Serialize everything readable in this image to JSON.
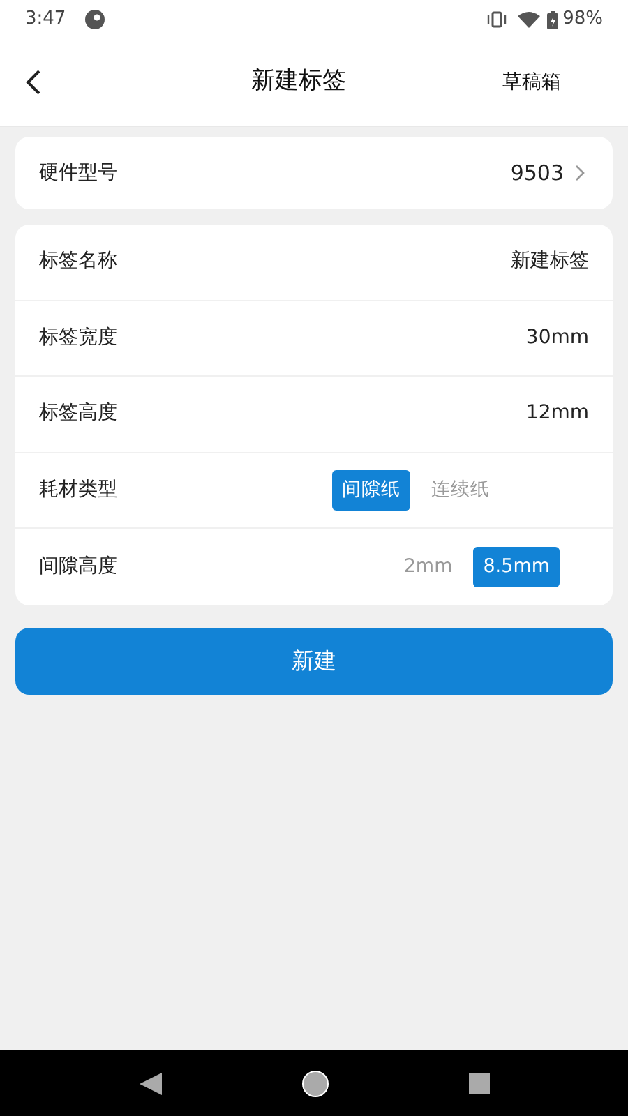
{
  "status_bar": {
    "time": "3:47",
    "battery": "98%"
  },
  "header": {
    "title": "新建标签",
    "action": "草稿箱"
  },
  "hardware": {
    "label": "硬件型号",
    "value": "9503"
  },
  "fields": [
    {
      "kind": "text",
      "label": "标签名称",
      "value": "新建标签"
    },
    {
      "kind": "text",
      "label": "标签宽度",
      "value": "30mm"
    },
    {
      "kind": "text",
      "label": "标签高度",
      "value": "12mm"
    },
    {
      "kind": "options",
      "label": "耗材类型",
      "options": [
        {
          "label": "间隙纸",
          "selected": true
        },
        {
          "label": "连续纸",
          "selected": false
        }
      ]
    },
    {
      "kind": "options",
      "label": "间隙高度",
      "options": [
        {
          "label": "2mm",
          "selected": false
        },
        {
          "label": "8.5mm",
          "selected": true
        }
      ]
    }
  ],
  "create_button": "新建"
}
